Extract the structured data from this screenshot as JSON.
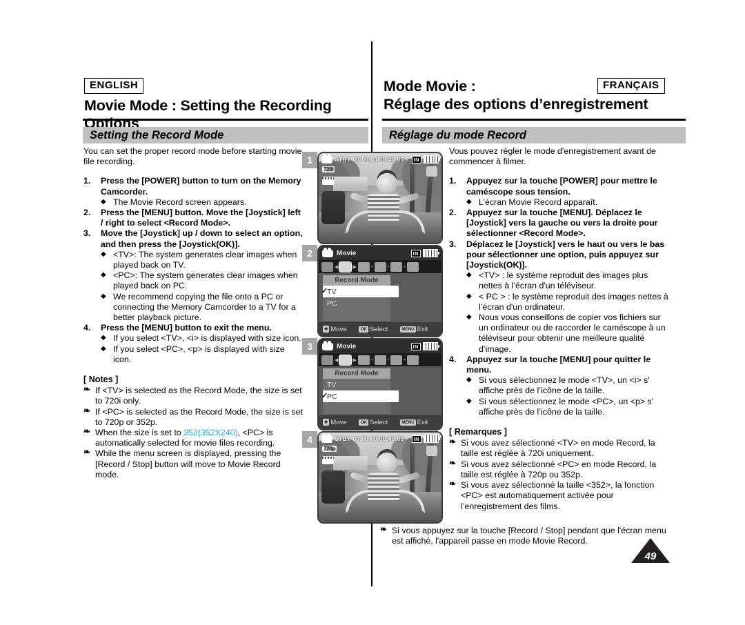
{
  "page": {
    "number": "49"
  },
  "english": {
    "lang_tag": "ENGLISH",
    "title": "Movie Mode : Setting the Recording Options",
    "section_title": "Setting the Record Mode",
    "intro": "You can set the proper record mode before starting movie file recording.",
    "steps": [
      {
        "num": "1.",
        "text": "Press the [POWER] button to turn on the Memory Camcorder.",
        "subs": [
          "The Movie Record screen appears."
        ]
      },
      {
        "num": "2.",
        "text": "Press the [MENU] button. Move the [Joystick] left / right to select <Record Mode>.",
        "subs": []
      },
      {
        "num": "3.",
        "text": "Move the [Joystick] up / down to select an option, and then press the [Joystick(OK)].",
        "subs": [
          "<TV>: The system generates clear images when played back on TV.",
          "<PC>: The system generates clear images when played back on PC.",
          "We recommend copying the file onto a PC or connecting the Memory Camcorder to a TV for a better playback picture."
        ]
      },
      {
        "num": "4.",
        "text": "Press the [MENU] button to exit the menu.",
        "subs": [
          "If you select <TV>, <i> is displayed with size icon.",
          "If you select <PC>, <p> is displayed with size icon."
        ]
      }
    ],
    "notes_title": "[ Notes ]",
    "notes": [
      {
        "pre": "If <TV> is selected as the Record Mode, the size is set to 720i only.",
        "hl": "",
        "post": ""
      },
      {
        "pre": "If <PC> is selected as the Record Mode, the size is set to 720p or 352p.",
        "hl": "",
        "post": ""
      },
      {
        "pre": "When the size is set to ",
        "hl": "352(352X240)",
        "post": ", <PC> is automatically selected for movie files recording."
      },
      {
        "pre": "While the menu screen is displayed, pressing the [Record / Stop] button will move to Movie Record mode.",
        "hl": "",
        "post": ""
      }
    ]
  },
  "french": {
    "lang_tag": "FRANÇAIS",
    "title_line1": "Mode Movie :",
    "title_line2": "Réglage des options d’enregistrement",
    "section_title": "Réglage du mode Record",
    "intro": "Vous pouvez régler le mode d'enregistrement avant de commencer à filmer.",
    "steps": [
      {
        "num": "1.",
        "text": "Appuyez sur la touche [POWER] pour mettre le caméscope sous tension.",
        "subs": [
          "L’écran Movie Record apparaît."
        ]
      },
      {
        "num": "2.",
        "text": "Appuyez sur la touche [MENU]. Déplacez le [Joystick] vers la gauche ou vers la droite pour sélectionner <Record Mode>.",
        "subs": []
      },
      {
        "num": "3.",
        "text": "Déplacez le [Joystick] vers le haut ou vers le bas pour sélectionner une option, puis appuyez sur [Joystick(OK)].",
        "subs": [
          "<TV>  : le système reproduit des images plus nettes à l’écran d'un téléviseur.",
          "< PC > : le système reproduit des images nettes à l’écran d'un ordinateur.",
          "Nous vous conseillons de copier vos fichiers sur un ordinateur ou de raccorder le caméscope à un téléviseur pour obtenir une meilleure qualité d’image."
        ]
      },
      {
        "num": "4.",
        "text": "Appuyez sur la touche [MENU] pour quitter le menu.",
        "subs": [
          "Si vous sélectionnez le mode <TV>, un <i> s' affiche près de l’icône de la taille.",
          "Si vous sélectionnez le mode <PC>, un <p> s' affiche près de l’icône de la taille."
        ]
      }
    ],
    "notes_title": "[ Remarques ]",
    "notes": [
      "Si vous avez sélectionné <TV> en mode Record, la taille est réglée à 720i uniquement.",
      "Si vous avez sélectionné <PC> en mode Record, la taille est réglée à 720p ou 352p.",
      "Si vous avez sélectionné la taille <352>, la fonction <PC> est automatiquement activée pour l’enregistrement des films."
    ],
    "note_wide": "Si vous appuyez sur la touche [Record / Stop] pendant que l'écran menu est affiché, l'appareil passe en mode Movie Record."
  },
  "screens": [
    {
      "badge": "1",
      "type": "liveview",
      "status": "STBY",
      "timecode": "00:00:00/00:40:05",
      "card": "IN",
      "size_badge": "720i"
    },
    {
      "badge": "2",
      "type": "menu",
      "title": "Movie",
      "card": "IN",
      "menu_heading": "Record Mode",
      "options": [
        {
          "label": "TV",
          "selected": true
        },
        {
          "label": "PC",
          "selected": false
        }
      ],
      "help": [
        {
          "key": "✥",
          "label": "Move"
        },
        {
          "key": "OK",
          "label": "Select"
        },
        {
          "key": "MENU",
          "label": "Exit"
        }
      ]
    },
    {
      "badge": "3",
      "type": "menu",
      "title": "Movie",
      "card": "IN",
      "menu_heading": "Record Mode",
      "options": [
        {
          "label": "TV",
          "selected": false
        },
        {
          "label": "PC",
          "selected": true
        }
      ],
      "help": [
        {
          "key": "✥",
          "label": "Move"
        },
        {
          "key": "OK",
          "label": "Select"
        },
        {
          "key": "MENU",
          "label": "Exit"
        }
      ]
    },
    {
      "badge": "4",
      "type": "liveview",
      "status": "STBY",
      "timecode": "00:00:00/00:40:05",
      "card": "IN",
      "size_badge": "720p"
    }
  ]
}
